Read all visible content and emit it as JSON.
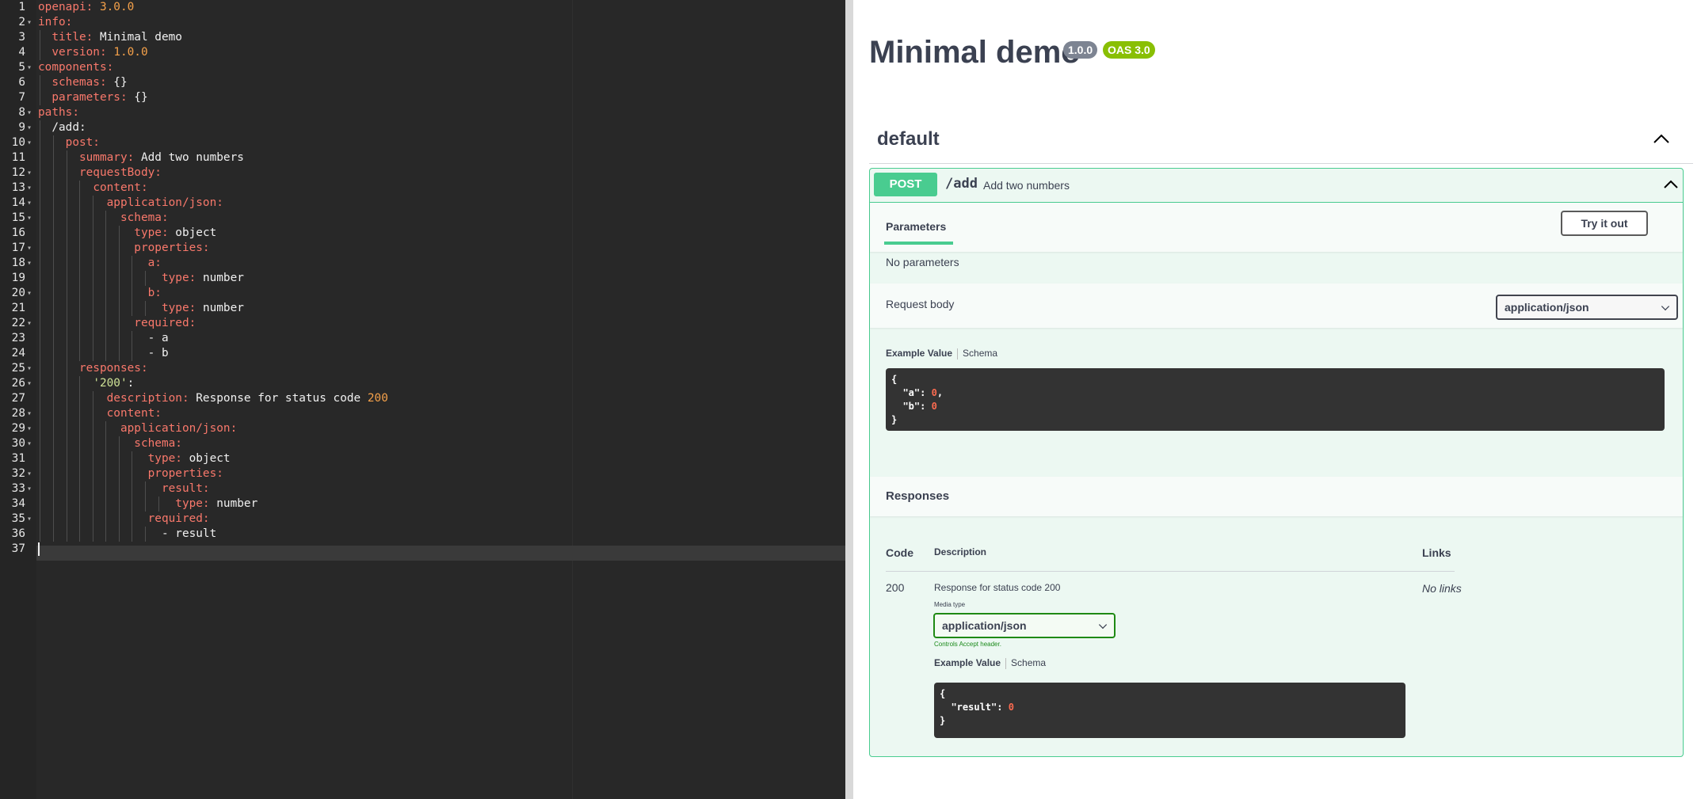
{
  "editor": {
    "lines": [
      {
        "n": "1",
        "fold": "",
        "parts": [
          {
            "t": "openapi:",
            "c": "k"
          },
          {
            "t": " "
          },
          {
            "t": "3.0.0",
            "c": "n"
          }
        ]
      },
      {
        "n": "2",
        "fold": "▾",
        "parts": [
          {
            "t": "info:",
            "c": "k"
          }
        ]
      },
      {
        "n": "3",
        "fold": "",
        "parts": [
          {
            "t": "  "
          },
          {
            "t": "title:",
            "c": "k"
          },
          {
            "t": " Minimal demo",
            "c": "v"
          }
        ]
      },
      {
        "n": "4",
        "fold": "",
        "parts": [
          {
            "t": "  "
          },
          {
            "t": "version:",
            "c": "k"
          },
          {
            "t": " "
          },
          {
            "t": "1.0.0",
            "c": "n"
          }
        ]
      },
      {
        "n": "5",
        "fold": "▾",
        "parts": [
          {
            "t": "components:",
            "c": "k"
          }
        ]
      },
      {
        "n": "6",
        "fold": "",
        "parts": [
          {
            "t": "  "
          },
          {
            "t": "schemas:",
            "c": "k"
          },
          {
            "t": " {}",
            "c": "v"
          }
        ]
      },
      {
        "n": "7",
        "fold": "",
        "parts": [
          {
            "t": "  "
          },
          {
            "t": "parameters:",
            "c": "k"
          },
          {
            "t": " {}",
            "c": "v"
          }
        ]
      },
      {
        "n": "8",
        "fold": "▾",
        "parts": [
          {
            "t": "paths:",
            "c": "k"
          }
        ]
      },
      {
        "n": "9",
        "fold": "▾",
        "parts": [
          {
            "t": "  "
          },
          {
            "t": "/add:",
            "c": "v"
          }
        ]
      },
      {
        "n": "10",
        "fold": "▾",
        "parts": [
          {
            "t": "    "
          },
          {
            "t": "post:",
            "c": "k"
          }
        ]
      },
      {
        "n": "11",
        "fold": "",
        "parts": [
          {
            "t": "      "
          },
          {
            "t": "summary:",
            "c": "k"
          },
          {
            "t": " Add two numbers",
            "c": "v"
          }
        ]
      },
      {
        "n": "12",
        "fold": "▾",
        "parts": [
          {
            "t": "      "
          },
          {
            "t": "requestBody:",
            "c": "k"
          }
        ]
      },
      {
        "n": "13",
        "fold": "▾",
        "parts": [
          {
            "t": "        "
          },
          {
            "t": "content:",
            "c": "k"
          }
        ]
      },
      {
        "n": "14",
        "fold": "▾",
        "parts": [
          {
            "t": "          "
          },
          {
            "t": "application/json:",
            "c": "k"
          }
        ]
      },
      {
        "n": "15",
        "fold": "▾",
        "parts": [
          {
            "t": "            "
          },
          {
            "t": "schema:",
            "c": "k"
          }
        ]
      },
      {
        "n": "16",
        "fold": "",
        "parts": [
          {
            "t": "              "
          },
          {
            "t": "type:",
            "c": "k"
          },
          {
            "t": " object",
            "c": "v"
          }
        ]
      },
      {
        "n": "17",
        "fold": "▾",
        "parts": [
          {
            "t": "              "
          },
          {
            "t": "properties:",
            "c": "k"
          }
        ]
      },
      {
        "n": "18",
        "fold": "▾",
        "parts": [
          {
            "t": "                "
          },
          {
            "t": "a:",
            "c": "k"
          }
        ]
      },
      {
        "n": "19",
        "fold": "",
        "parts": [
          {
            "t": "                  "
          },
          {
            "t": "type:",
            "c": "k"
          },
          {
            "t": " number",
            "c": "v"
          }
        ]
      },
      {
        "n": "20",
        "fold": "▾",
        "parts": [
          {
            "t": "                "
          },
          {
            "t": "b:",
            "c": "k"
          }
        ]
      },
      {
        "n": "21",
        "fold": "",
        "parts": [
          {
            "t": "                  "
          },
          {
            "t": "type:",
            "c": "k"
          },
          {
            "t": " number",
            "c": "v"
          }
        ]
      },
      {
        "n": "22",
        "fold": "▾",
        "parts": [
          {
            "t": "              "
          },
          {
            "t": "required:",
            "c": "k"
          }
        ]
      },
      {
        "n": "23",
        "fold": "",
        "parts": [
          {
            "t": "                - a",
            "c": "v"
          }
        ]
      },
      {
        "n": "24",
        "fold": "",
        "parts": [
          {
            "t": "                - b",
            "c": "v"
          }
        ]
      },
      {
        "n": "25",
        "fold": "▾",
        "parts": [
          {
            "t": "      "
          },
          {
            "t": "responses:",
            "c": "k"
          }
        ]
      },
      {
        "n": "26",
        "fold": "▾",
        "parts": [
          {
            "t": "        "
          },
          {
            "t": "'200'",
            "c": "s"
          },
          {
            "t": ":",
            "c": "v"
          }
        ]
      },
      {
        "n": "27",
        "fold": "",
        "parts": [
          {
            "t": "          "
          },
          {
            "t": "description:",
            "c": "k"
          },
          {
            "t": " Response for status code ",
            "c": "v"
          },
          {
            "t": "200",
            "c": "n"
          }
        ]
      },
      {
        "n": "28",
        "fold": "▾",
        "parts": [
          {
            "t": "          "
          },
          {
            "t": "content:",
            "c": "k"
          }
        ]
      },
      {
        "n": "29",
        "fold": "▾",
        "parts": [
          {
            "t": "            "
          },
          {
            "t": "application/json:",
            "c": "k"
          }
        ]
      },
      {
        "n": "30",
        "fold": "▾",
        "parts": [
          {
            "t": "              "
          },
          {
            "t": "schema:",
            "c": "k"
          }
        ]
      },
      {
        "n": "31",
        "fold": "",
        "parts": [
          {
            "t": "                "
          },
          {
            "t": "type:",
            "c": "k"
          },
          {
            "t": " object",
            "c": "v"
          }
        ]
      },
      {
        "n": "32",
        "fold": "▾",
        "parts": [
          {
            "t": "                "
          },
          {
            "t": "properties:",
            "c": "k"
          }
        ]
      },
      {
        "n": "33",
        "fold": "▾",
        "parts": [
          {
            "t": "                  "
          },
          {
            "t": "result:",
            "c": "k"
          }
        ]
      },
      {
        "n": "34",
        "fold": "",
        "parts": [
          {
            "t": "                    "
          },
          {
            "t": "type:",
            "c": "k"
          },
          {
            "t": " number",
            "c": "v"
          }
        ]
      },
      {
        "n": "35",
        "fold": "▾",
        "parts": [
          {
            "t": "                "
          },
          {
            "t": "required:",
            "c": "k"
          }
        ]
      },
      {
        "n": "36",
        "fold": "",
        "parts": [
          {
            "t": "                  - result",
            "c": "v"
          }
        ]
      },
      {
        "n": "37",
        "fold": "",
        "parts": []
      }
    ]
  },
  "swagger": {
    "title": "Minimal demo",
    "version_badge": "1.0.0",
    "oas_badge": "OAS 3.0",
    "tag": "default",
    "operation": {
      "method": "POST",
      "path": "/add",
      "summary": "Add two numbers",
      "parameters_tab": "Parameters",
      "try_button": "Try it out",
      "no_parameters": "No parameters",
      "request_body_label": "Request body",
      "request_content_type": "application/json",
      "example_value_tab": "Example Value",
      "schema_tab": "Schema",
      "request_example": {
        "a": "0",
        "b": "0"
      },
      "responses_label": "Responses",
      "columns": {
        "code": "Code",
        "description": "Description",
        "links": "Links"
      },
      "response": {
        "code": "200",
        "description": "Response for status code 200",
        "links": "No links",
        "media_type_label": "Media type",
        "media_type": "application/json",
        "controls_accept": "Controls Accept header.",
        "example_value_tab": "Example Value",
        "schema_tab": "Schema",
        "example": {
          "result": "0"
        }
      }
    }
  }
}
